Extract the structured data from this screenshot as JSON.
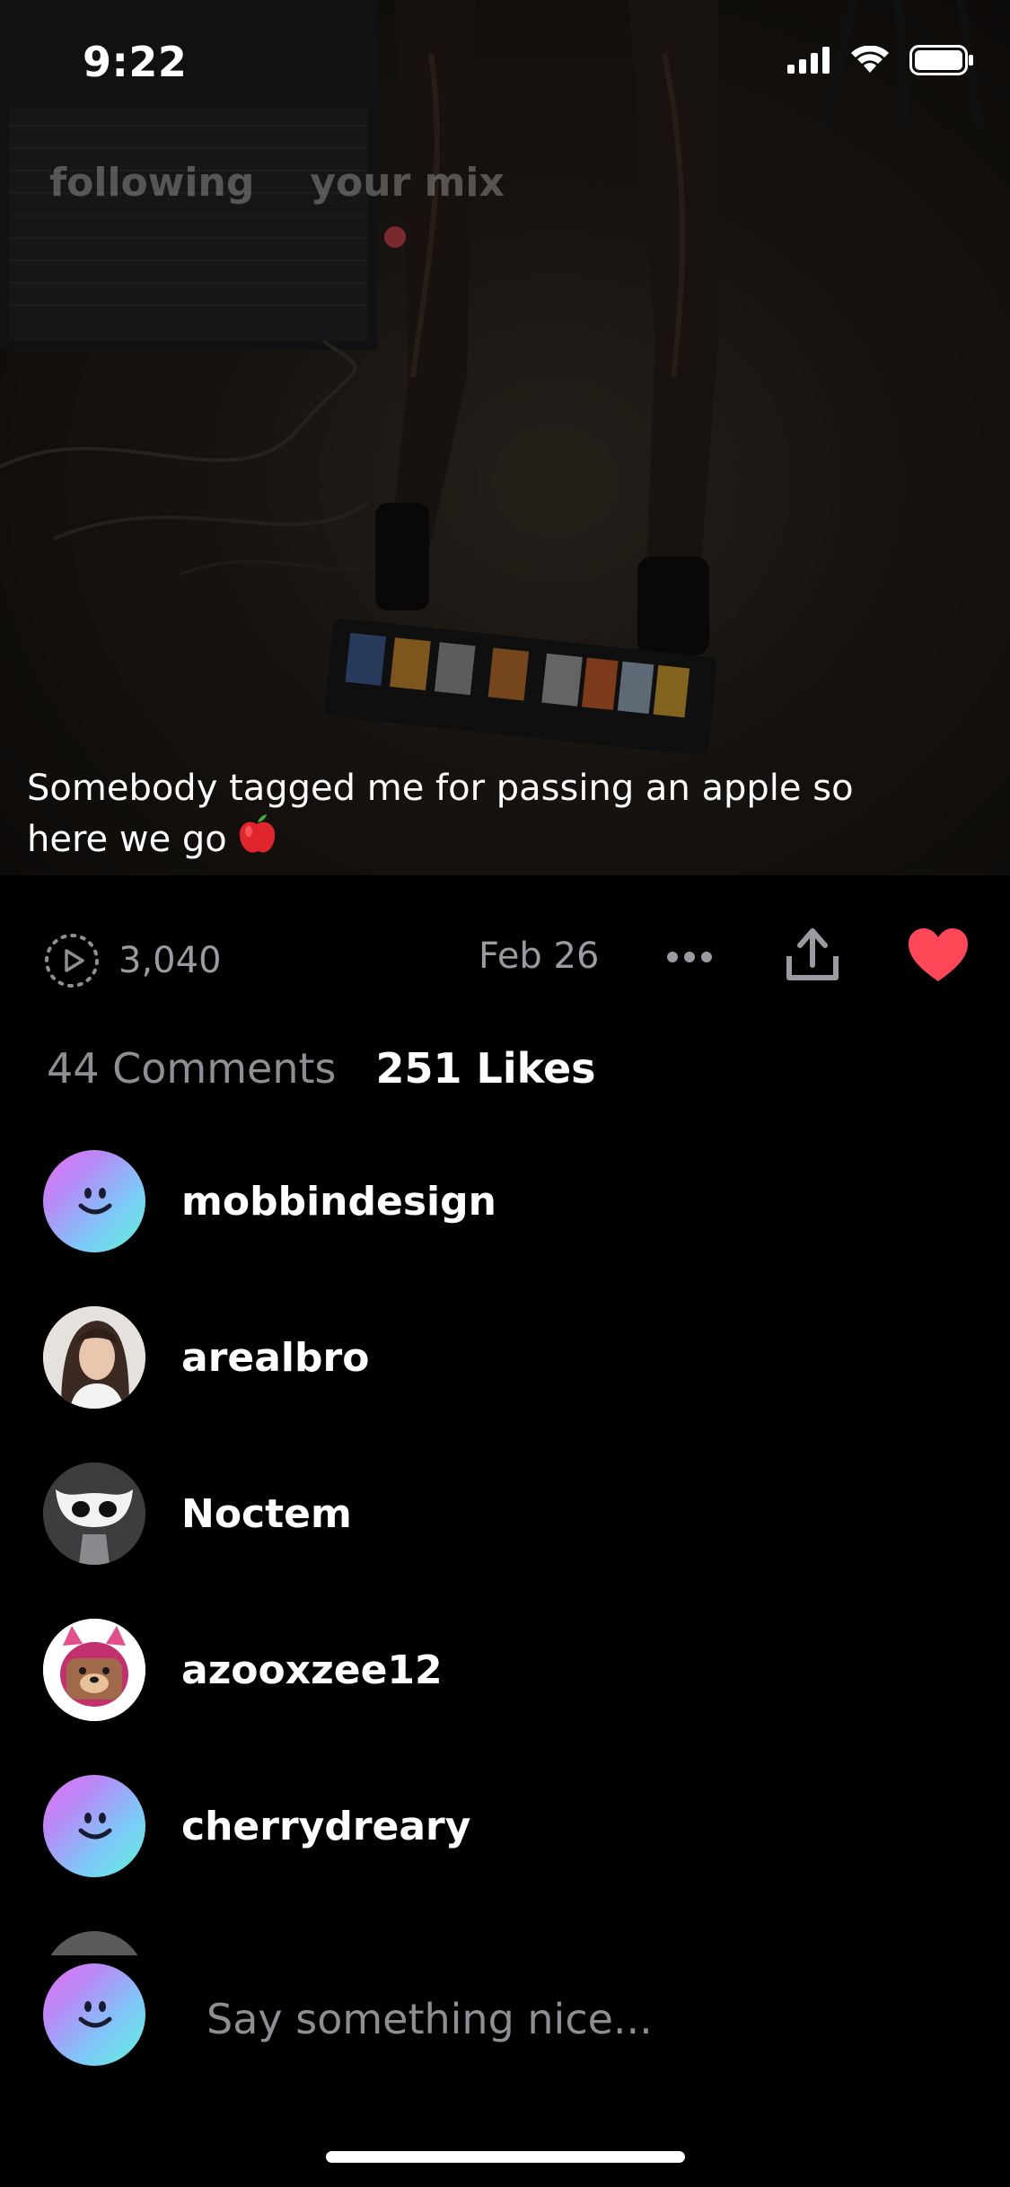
{
  "status_bar": {
    "time": "9:22"
  },
  "feed_tabs": [
    {
      "label": "following"
    },
    {
      "label": "your mix"
    }
  ],
  "post": {
    "caption": "Somebody tagged me for passing an apple so here we go"
  },
  "stats": {
    "views": "3,040",
    "date": "Feb 26"
  },
  "activity_tabs": {
    "comments": "44 Comments",
    "likes": "251 Likes"
  },
  "likes": [
    {
      "username": "mobbindesign",
      "avatar": "smiley-gradient"
    },
    {
      "username": "arealbro",
      "avatar": "photo"
    },
    {
      "username": "Noctem",
      "avatar": "masked-character"
    },
    {
      "username": "azooxzee12",
      "avatar": "bear-character"
    },
    {
      "username": "cherrydreary",
      "avatar": "smiley-gradient"
    }
  ],
  "composer": {
    "placeholder": "Say something nice..."
  },
  "colors": {
    "like_heart": "#ff4757",
    "gradient": [
      "#e66ff2",
      "#7ec8f9",
      "#5ff3d7"
    ],
    "secondary_text": "#8e8e93"
  }
}
